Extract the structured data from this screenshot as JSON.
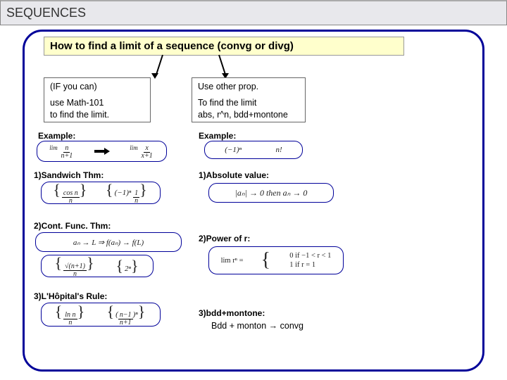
{
  "header": {
    "title": "SEQUENCES"
  },
  "main": {
    "title": "How to find a limit of a sequence (convg or divg)",
    "left_option": {
      "line1": "(IF you can)",
      "line2a": "use Math-101",
      "line2b": "to find the limit."
    },
    "right_option": {
      "line1": "Use other prop.",
      "line2a": "To find the limit",
      "line2b": "abs, r^n, bdd+montone"
    },
    "left": {
      "example_label": "Example:",
      "example_math_a": "lim n/(n+1)",
      "example_math_b": "lim x/(x+1)",
      "s1": {
        "title": "1)Sandwich Thm:",
        "items": [
          "{cos n / n}",
          "{(−1)ⁿ 1/n}"
        ]
      },
      "s2": {
        "title": "2)Cont. Func. Thm:",
        "line": "aₙ → L ⇒ f(aₙ) → f(L)",
        "items": [
          "{√(n+1)/n}",
          "{2ⁿ}"
        ]
      },
      "s3": {
        "title": "3)L'Hôpital's Rule:",
        "items": [
          "{ln n / n}",
          "{((n−1)/(n+1))ⁿ}"
        ]
      }
    },
    "right": {
      "example_label": "Example:",
      "example_items": [
        "(−1)ⁿ",
        "n!"
      ],
      "s1": {
        "title": "1)Absolute value:",
        "line": "|aₙ| → 0 then aₙ → 0"
      },
      "s2": {
        "title": "2)Power of r:",
        "line_lhs": "lim rⁿ =",
        "case1": "0   if  −1 < r < 1",
        "case2": "1   if   r = 1"
      },
      "s3": {
        "title": "3)bdd+montone:",
        "text": "Bdd + monton → convg"
      }
    }
  }
}
